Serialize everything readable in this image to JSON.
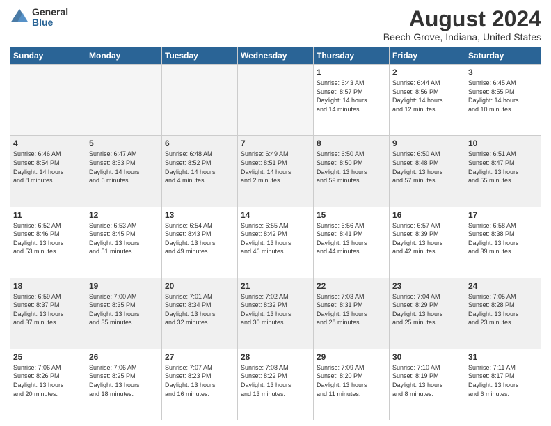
{
  "header": {
    "logo_general": "General",
    "logo_blue": "Blue",
    "main_title": "August 2024",
    "subtitle": "Beech Grove, Indiana, United States"
  },
  "calendar": {
    "days_of_week": [
      "Sunday",
      "Monday",
      "Tuesday",
      "Wednesday",
      "Thursday",
      "Friday",
      "Saturday"
    ],
    "weeks": [
      [
        {
          "day": "",
          "info": ""
        },
        {
          "day": "",
          "info": ""
        },
        {
          "day": "",
          "info": ""
        },
        {
          "day": "",
          "info": ""
        },
        {
          "day": "1",
          "info": "Sunrise: 6:43 AM\nSunset: 8:57 PM\nDaylight: 14 hours\nand 14 minutes."
        },
        {
          "day": "2",
          "info": "Sunrise: 6:44 AM\nSunset: 8:56 PM\nDaylight: 14 hours\nand 12 minutes."
        },
        {
          "day": "3",
          "info": "Sunrise: 6:45 AM\nSunset: 8:55 PM\nDaylight: 14 hours\nand 10 minutes."
        }
      ],
      [
        {
          "day": "4",
          "info": "Sunrise: 6:46 AM\nSunset: 8:54 PM\nDaylight: 14 hours\nand 8 minutes."
        },
        {
          "day": "5",
          "info": "Sunrise: 6:47 AM\nSunset: 8:53 PM\nDaylight: 14 hours\nand 6 minutes."
        },
        {
          "day": "6",
          "info": "Sunrise: 6:48 AM\nSunset: 8:52 PM\nDaylight: 14 hours\nand 4 minutes."
        },
        {
          "day": "7",
          "info": "Sunrise: 6:49 AM\nSunset: 8:51 PM\nDaylight: 14 hours\nand 2 minutes."
        },
        {
          "day": "8",
          "info": "Sunrise: 6:50 AM\nSunset: 8:50 PM\nDaylight: 13 hours\nand 59 minutes."
        },
        {
          "day": "9",
          "info": "Sunrise: 6:50 AM\nSunset: 8:48 PM\nDaylight: 13 hours\nand 57 minutes."
        },
        {
          "day": "10",
          "info": "Sunrise: 6:51 AM\nSunset: 8:47 PM\nDaylight: 13 hours\nand 55 minutes."
        }
      ],
      [
        {
          "day": "11",
          "info": "Sunrise: 6:52 AM\nSunset: 8:46 PM\nDaylight: 13 hours\nand 53 minutes."
        },
        {
          "day": "12",
          "info": "Sunrise: 6:53 AM\nSunset: 8:45 PM\nDaylight: 13 hours\nand 51 minutes."
        },
        {
          "day": "13",
          "info": "Sunrise: 6:54 AM\nSunset: 8:43 PM\nDaylight: 13 hours\nand 49 minutes."
        },
        {
          "day": "14",
          "info": "Sunrise: 6:55 AM\nSunset: 8:42 PM\nDaylight: 13 hours\nand 46 minutes."
        },
        {
          "day": "15",
          "info": "Sunrise: 6:56 AM\nSunset: 8:41 PM\nDaylight: 13 hours\nand 44 minutes."
        },
        {
          "day": "16",
          "info": "Sunrise: 6:57 AM\nSunset: 8:39 PM\nDaylight: 13 hours\nand 42 minutes."
        },
        {
          "day": "17",
          "info": "Sunrise: 6:58 AM\nSunset: 8:38 PM\nDaylight: 13 hours\nand 39 minutes."
        }
      ],
      [
        {
          "day": "18",
          "info": "Sunrise: 6:59 AM\nSunset: 8:37 PM\nDaylight: 13 hours\nand 37 minutes."
        },
        {
          "day": "19",
          "info": "Sunrise: 7:00 AM\nSunset: 8:35 PM\nDaylight: 13 hours\nand 35 minutes."
        },
        {
          "day": "20",
          "info": "Sunrise: 7:01 AM\nSunset: 8:34 PM\nDaylight: 13 hours\nand 32 minutes."
        },
        {
          "day": "21",
          "info": "Sunrise: 7:02 AM\nSunset: 8:32 PM\nDaylight: 13 hours\nand 30 minutes."
        },
        {
          "day": "22",
          "info": "Sunrise: 7:03 AM\nSunset: 8:31 PM\nDaylight: 13 hours\nand 28 minutes."
        },
        {
          "day": "23",
          "info": "Sunrise: 7:04 AM\nSunset: 8:29 PM\nDaylight: 13 hours\nand 25 minutes."
        },
        {
          "day": "24",
          "info": "Sunrise: 7:05 AM\nSunset: 8:28 PM\nDaylight: 13 hours\nand 23 minutes."
        }
      ],
      [
        {
          "day": "25",
          "info": "Sunrise: 7:06 AM\nSunset: 8:26 PM\nDaylight: 13 hours\nand 20 minutes."
        },
        {
          "day": "26",
          "info": "Sunrise: 7:06 AM\nSunset: 8:25 PM\nDaylight: 13 hours\nand 18 minutes."
        },
        {
          "day": "27",
          "info": "Sunrise: 7:07 AM\nSunset: 8:23 PM\nDaylight: 13 hours\nand 16 minutes."
        },
        {
          "day": "28",
          "info": "Sunrise: 7:08 AM\nSunset: 8:22 PM\nDaylight: 13 hours\nand 13 minutes."
        },
        {
          "day": "29",
          "info": "Sunrise: 7:09 AM\nSunset: 8:20 PM\nDaylight: 13 hours\nand 11 minutes."
        },
        {
          "day": "30",
          "info": "Sunrise: 7:10 AM\nSunset: 8:19 PM\nDaylight: 13 hours\nand 8 minutes."
        },
        {
          "day": "31",
          "info": "Sunrise: 7:11 AM\nSunset: 8:17 PM\nDaylight: 13 hours\nand 6 minutes."
        }
      ]
    ]
  }
}
